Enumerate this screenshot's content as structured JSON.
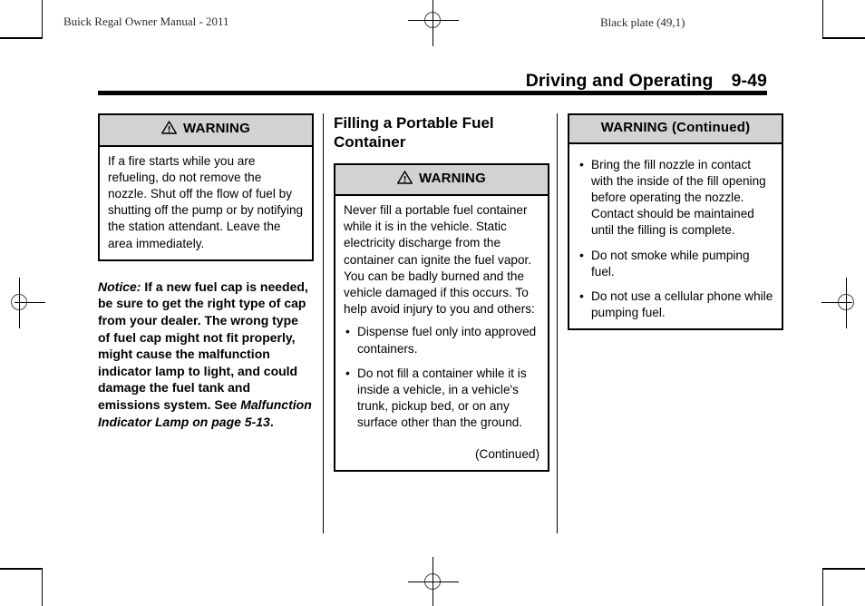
{
  "running_head": {
    "left": "Buick Regal Owner Manual - 2011",
    "right": "Black plate (49,1)"
  },
  "section_heading": {
    "title": "Driving and Operating",
    "page_number": "9-49"
  },
  "colors": {
    "warning_header_bg": "#d2d2d2",
    "rule": "#000000",
    "text": "#000000"
  },
  "column1": {
    "warning_box": {
      "icon": "warning-triangle-icon",
      "header": "WARNING",
      "body": "If a fire starts while you are refueling, do not remove the nozzle. Shut off the flow of fuel by shutting off the pump or by notifying the station attendant. Leave the area immediately."
    },
    "notice": {
      "lead": "Notice:",
      "text": " If a new fuel cap is needed, be sure to get the right type of cap from your dealer. The wrong type of fuel cap might not fit properly, might cause the malfunction indicator lamp to light, and could damage the fuel tank and emissions system. See ",
      "xref": "Malfunction Indicator Lamp on page 5-13",
      "tail": "."
    }
  },
  "column2": {
    "subhead": "Filling a Portable Fuel Container",
    "warning_box": {
      "icon": "warning-triangle-icon",
      "header": "WARNING",
      "body": "Never fill a portable fuel container while it is in the vehicle. Static electricity discharge from the container can ignite the fuel vapor. You can be badly burned and the vehicle damaged if this occurs. To help avoid injury to you and others:",
      "bullets": [
        "Dispense fuel only into approved containers.",
        "Do not fill a container while it is inside a vehicle, in a vehicle's trunk, pickup bed, or on any surface other than the ground."
      ],
      "continued": "(Continued)"
    }
  },
  "column3": {
    "warning_box": {
      "header": "WARNING  (Continued)",
      "bullets": [
        "Bring the fill nozzle in contact with the inside of the fill opening before operating the nozzle. Contact should be maintained until the filling is complete.",
        "Do not smoke while pumping fuel.",
        "Do not use a cellular phone while pumping fuel."
      ]
    }
  }
}
